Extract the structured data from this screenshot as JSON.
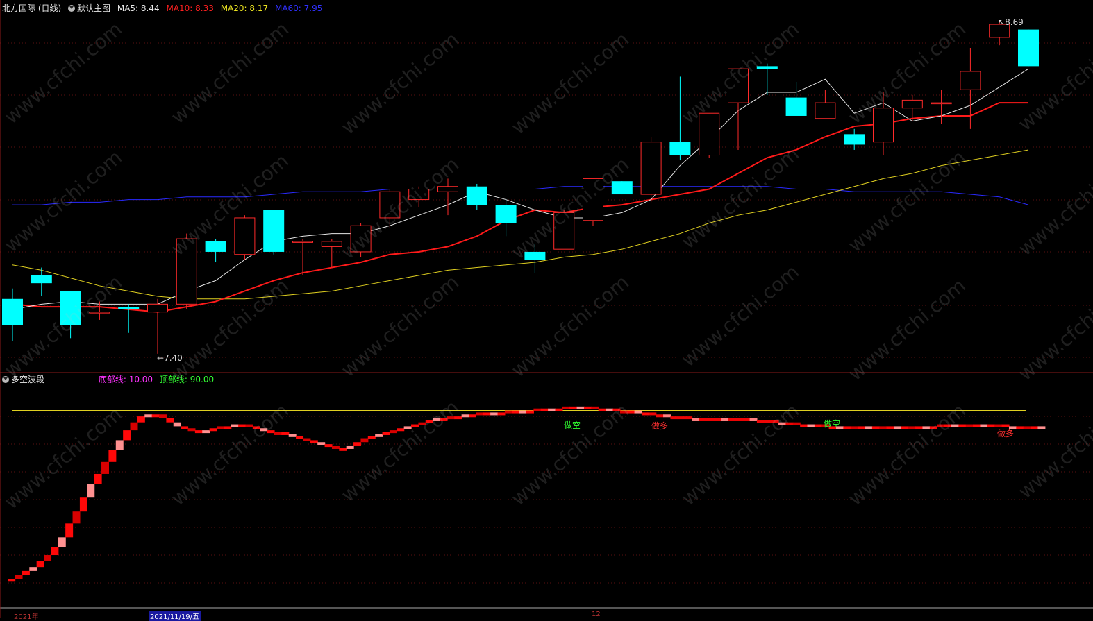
{
  "header": {
    "stock_title": "北方国际 (日线)",
    "chart_template": "默认主图",
    "ma5": "MA5: 8.44",
    "ma10": "MA10: 8.33",
    "ma20": "MA20: 8.17",
    "ma60": "MA60: 7.95"
  },
  "indicator": {
    "name": "多空波段",
    "bottom_line": "底部线: 10.00",
    "top_line": "顶部线: 90.00"
  },
  "annotations": {
    "high": "8.69",
    "low": "7.40",
    "band_labels": [
      "做空",
      "做多",
      "做空",
      "做多"
    ]
  },
  "dates": [
    "2021年",
    "2021/11/19/五",
    "12"
  ],
  "watermark": "www.cfchi.com",
  "colors": {
    "up": "#ff2a2a",
    "down": "#00ffff",
    "ma5": "#e6e6e6",
    "ma10": "#ff1a1a",
    "ma20": "#e0d020",
    "ma60": "#2a2aff",
    "band_red": "#ff1010",
    "band_green": "#10d010"
  },
  "chart_data": {
    "type": "candlestick",
    "candles": [
      {
        "o": 7.63,
        "h": 7.67,
        "l": 7.47,
        "c": 7.53
      },
      {
        "o": 7.72,
        "h": 7.75,
        "l": 7.64,
        "c": 7.69
      },
      {
        "o": 7.66,
        "h": 7.66,
        "l": 7.48,
        "c": 7.53
      },
      {
        "o": 7.58,
        "h": 7.62,
        "l": 7.55,
        "c": 7.58
      },
      {
        "o": 7.6,
        "h": 7.61,
        "l": 7.5,
        "c": 7.59
      },
      {
        "o": 7.58,
        "h": 7.63,
        "l": 7.42,
        "c": 7.61
      },
      {
        "o": 7.61,
        "h": 7.88,
        "l": 7.59,
        "c": 7.86
      },
      {
        "o": 7.85,
        "h": 7.86,
        "l": 7.77,
        "c": 7.81
      },
      {
        "o": 7.8,
        "h": 7.95,
        "l": 7.78,
        "c": 7.94
      },
      {
        "o": 7.97,
        "h": 7.97,
        "l": 7.8,
        "c": 7.81
      },
      {
        "o": 7.85,
        "h": 7.86,
        "l": 7.72,
        "c": 7.85
      },
      {
        "o": 7.83,
        "h": 7.86,
        "l": 7.75,
        "c": 7.85
      },
      {
        "o": 7.81,
        "h": 7.92,
        "l": 7.79,
        "c": 7.91
      },
      {
        "o": 7.94,
        "h": 8.05,
        "l": 7.9,
        "c": 8.04
      },
      {
        "o": 8.01,
        "h": 8.06,
        "l": 7.98,
        "c": 8.05
      },
      {
        "o": 8.04,
        "h": 8.09,
        "l": 7.95,
        "c": 8.06
      },
      {
        "o": 8.06,
        "h": 8.07,
        "l": 7.97,
        "c": 7.99
      },
      {
        "o": 7.99,
        "h": 8.01,
        "l": 7.87,
        "c": 7.92
      },
      {
        "o": 7.81,
        "h": 7.84,
        "l": 7.73,
        "c": 7.78
      },
      {
        "o": 7.82,
        "h": 7.97,
        "l": 7.82,
        "c": 7.96
      },
      {
        "o": 7.93,
        "h": 8.08,
        "l": 7.91,
        "c": 8.09
      },
      {
        "o": 8.08,
        "h": 8.08,
        "l": 8.03,
        "c": 8.03
      },
      {
        "o": 8.03,
        "h": 8.25,
        "l": 8.0,
        "c": 8.23
      },
      {
        "o": 8.23,
        "h": 8.48,
        "l": 8.16,
        "c": 8.18
      },
      {
        "o": 8.18,
        "h": 8.34,
        "l": 8.17,
        "c": 8.34
      },
      {
        "o": 8.38,
        "h": 8.5,
        "l": 8.2,
        "c": 8.51
      },
      {
        "o": 8.52,
        "h": 8.53,
        "l": 8.41,
        "c": 8.51
      },
      {
        "o": 8.4,
        "h": 8.46,
        "l": 8.33,
        "c": 8.33
      },
      {
        "o": 8.32,
        "h": 8.43,
        "l": 8.32,
        "c": 8.38
      },
      {
        "o": 8.26,
        "h": 8.28,
        "l": 8.2,
        "c": 8.22
      },
      {
        "o": 8.23,
        "h": 8.42,
        "l": 8.18,
        "c": 8.36
      },
      {
        "o": 8.36,
        "h": 8.41,
        "l": 8.31,
        "c": 8.39
      },
      {
        "o": 8.38,
        "h": 8.43,
        "l": 8.3,
        "c": 8.38
      },
      {
        "o": 8.43,
        "h": 8.59,
        "l": 8.28,
        "c": 8.5
      },
      {
        "o": 8.63,
        "h": 8.69,
        "l": 8.6,
        "c": 8.68
      },
      {
        "o": 8.66,
        "h": 8.66,
        "l": 8.52,
        "c": 8.52
      }
    ],
    "ma5": [
      7.59,
      7.61,
      7.62,
      7.61,
      7.61,
      7.61,
      7.66,
      7.7,
      7.78,
      7.85,
      7.87,
      7.88,
      7.88,
      7.91,
      7.95,
      7.99,
      8.04,
      8.01,
      7.97,
      7.94,
      7.94,
      7.96,
      8.01,
      8.14,
      8.24,
      8.35,
      8.42,
      8.42,
      8.47,
      8.34,
      8.38,
      8.31,
      8.33,
      8.37,
      8.44,
      8.51
    ],
    "ma10": [
      7.61,
      7.6,
      7.6,
      7.6,
      7.59,
      7.58,
      7.6,
      7.62,
      7.66,
      7.7,
      7.73,
      7.75,
      7.77,
      7.8,
      7.81,
      7.83,
      7.87,
      7.93,
      7.97,
      7.96,
      7.98,
      7.99,
      8.01,
      8.03,
      8.05,
      8.11,
      8.17,
      8.2,
      8.25,
      8.29,
      8.3,
      8.32,
      8.33,
      8.33,
      8.38,
      8.38
    ],
    "ma20": [
      7.76,
      7.74,
      7.71,
      7.68,
      7.66,
      7.64,
      7.63,
      7.63,
      7.63,
      7.64,
      7.65,
      7.66,
      7.68,
      7.7,
      7.72,
      7.74,
      7.75,
      7.76,
      7.77,
      7.79,
      7.8,
      7.82,
      7.85,
      7.88,
      7.92,
      7.95,
      7.97,
      8.0,
      8.03,
      8.06,
      8.09,
      8.11,
      8.14,
      8.16,
      8.18,
      8.2
    ],
    "ma60": [
      7.99,
      7.99,
      8.0,
      8.0,
      8.01,
      8.01,
      8.02,
      8.02,
      8.02,
      8.03,
      8.04,
      8.04,
      8.04,
      8.05,
      8.05,
      8.05,
      8.05,
      8.05,
      8.05,
      8.06,
      8.06,
      8.06,
      8.06,
      8.06,
      8.06,
      8.06,
      8.06,
      8.05,
      8.05,
      8.04,
      8.04,
      8.04,
      8.04,
      8.03,
      8.02,
      7.99
    ],
    "ylim": [
      7.38,
      8.72
    ],
    "band": {
      "bottom": 10,
      "top": 90,
      "ylim": [
        -4,
        100
      ],
      "values": [
        4,
        5,
        7,
        9,
        11,
        14,
        17,
        21,
        26,
        33,
        39,
        46,
        53,
        58,
        64,
        70,
        75,
        80,
        84,
        87,
        88,
        88,
        86,
        84,
        82,
        81,
        80,
        80,
        80,
        81,
        82,
        82,
        83,
        83,
        82,
        81,
        80,
        79,
        79,
        78,
        77,
        76,
        75,
        74,
        73,
        72,
        71,
        71,
        72,
        74,
        76,
        77,
        78,
        79,
        80,
        81,
        82,
        83,
        84,
        85,
        86,
        86,
        87,
        87,
        88,
        88,
        89,
        89,
        89,
        89,
        90,
        90,
        90,
        90,
        91,
        91,
        91,
        91,
        92,
        92,
        92,
        92,
        91,
        91,
        91,
        90,
        90,
        90,
        89,
        89,
        88,
        88,
        87,
        87,
        87,
        86,
        86,
        86,
        86,
        86,
        86,
        86,
        86,
        86,
        85,
        85,
        85,
        84,
        84,
        84,
        83,
        83,
        83,
        83,
        82,
        82,
        82,
        82,
        82,
        82,
        82,
        82,
        82,
        82,
        82,
        82,
        82,
        82,
        82,
        82,
        83,
        83,
        83,
        83,
        83,
        83,
        83,
        83,
        83,
        82,
        82,
        82,
        82,
        82,
        82
      ]
    }
  }
}
